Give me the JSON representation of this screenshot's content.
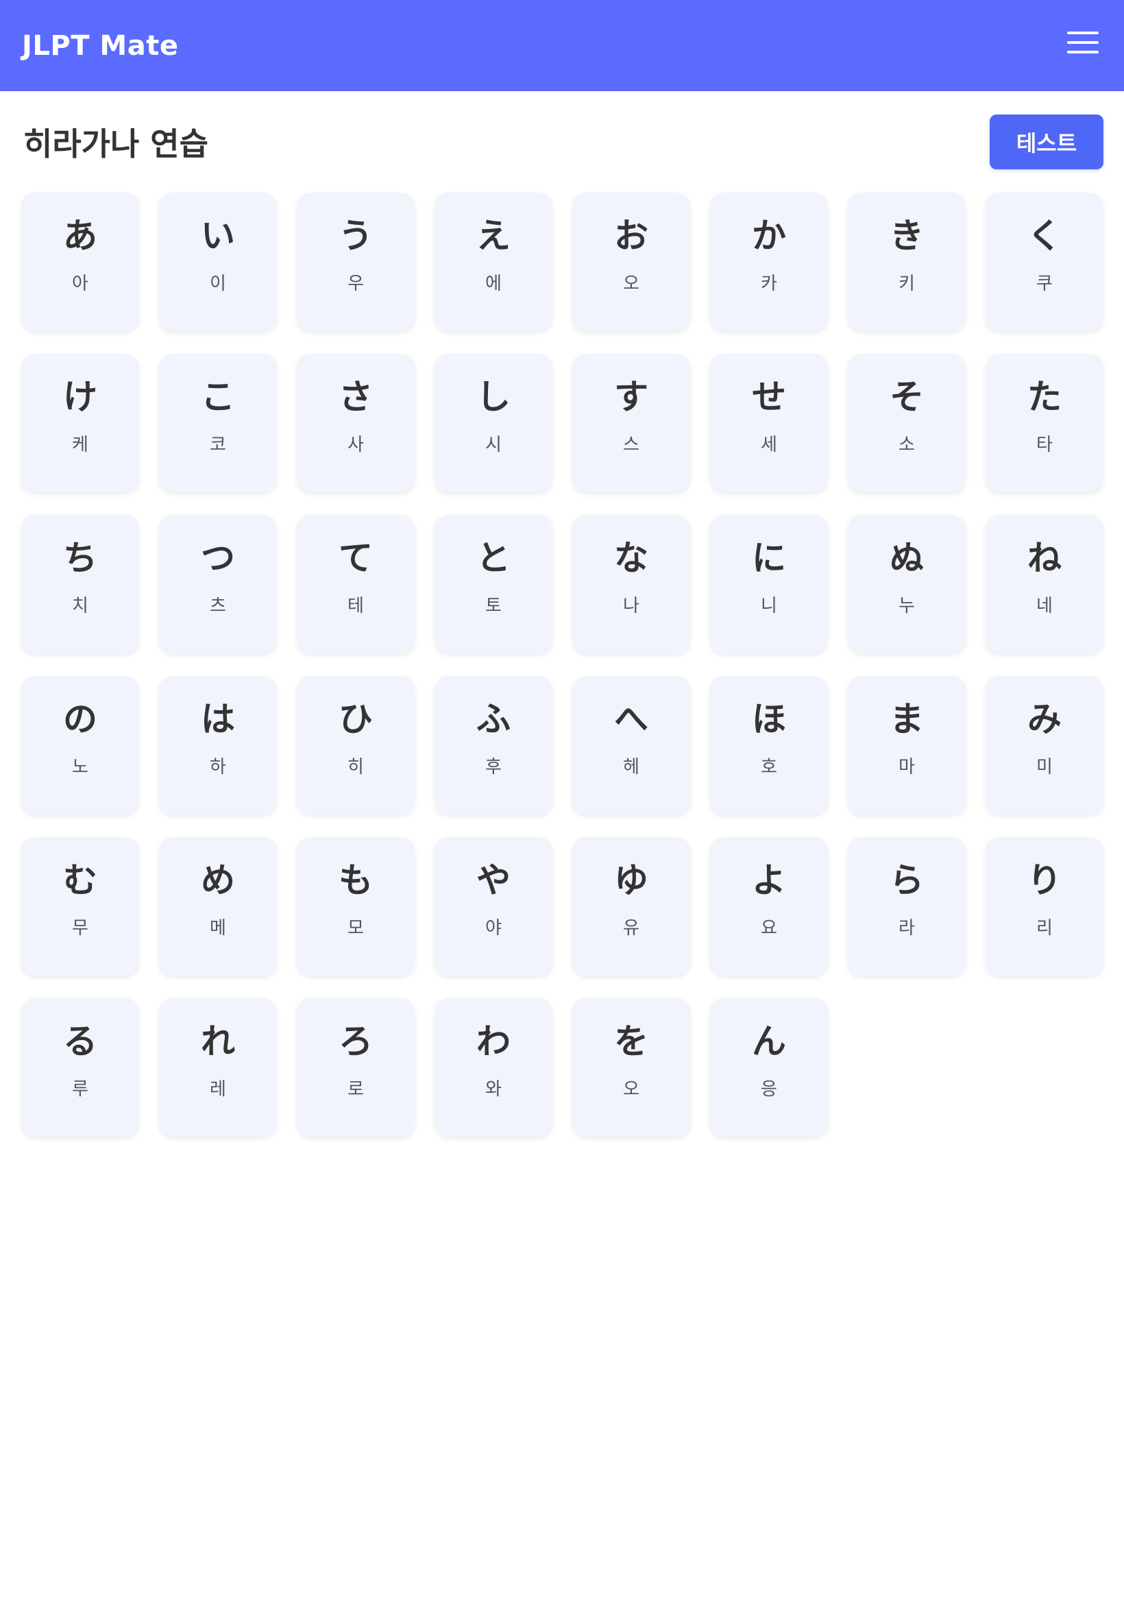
{
  "header": {
    "title": "JLPT Mate",
    "menu_icon": "hamburger-menu-icon"
  },
  "page": {
    "title": "히라가나 연습",
    "test_button": "테스트"
  },
  "colors": {
    "header_bg": "#5b6bff",
    "button_bg": "#4f67f7",
    "card_bg": "#f1f3fd",
    "text": "#333333"
  },
  "cards": [
    {
      "kana": "あ",
      "reading": "아"
    },
    {
      "kana": "い",
      "reading": "이"
    },
    {
      "kana": "う",
      "reading": "우"
    },
    {
      "kana": "え",
      "reading": "에"
    },
    {
      "kana": "お",
      "reading": "오"
    },
    {
      "kana": "か",
      "reading": "카"
    },
    {
      "kana": "き",
      "reading": "키"
    },
    {
      "kana": "く",
      "reading": "쿠"
    },
    {
      "kana": "け",
      "reading": "케"
    },
    {
      "kana": "こ",
      "reading": "코"
    },
    {
      "kana": "さ",
      "reading": "사"
    },
    {
      "kana": "し",
      "reading": "시"
    },
    {
      "kana": "す",
      "reading": "스"
    },
    {
      "kana": "せ",
      "reading": "세"
    },
    {
      "kana": "そ",
      "reading": "소"
    },
    {
      "kana": "た",
      "reading": "타"
    },
    {
      "kana": "ち",
      "reading": "치"
    },
    {
      "kana": "つ",
      "reading": "츠"
    },
    {
      "kana": "て",
      "reading": "테"
    },
    {
      "kana": "と",
      "reading": "토"
    },
    {
      "kana": "な",
      "reading": "나"
    },
    {
      "kana": "に",
      "reading": "니"
    },
    {
      "kana": "ぬ",
      "reading": "누"
    },
    {
      "kana": "ね",
      "reading": "네"
    },
    {
      "kana": "の",
      "reading": "노"
    },
    {
      "kana": "は",
      "reading": "하"
    },
    {
      "kana": "ひ",
      "reading": "히"
    },
    {
      "kana": "ふ",
      "reading": "후"
    },
    {
      "kana": "へ",
      "reading": "헤"
    },
    {
      "kana": "ほ",
      "reading": "호"
    },
    {
      "kana": "ま",
      "reading": "마"
    },
    {
      "kana": "み",
      "reading": "미"
    },
    {
      "kana": "む",
      "reading": "무"
    },
    {
      "kana": "め",
      "reading": "메"
    },
    {
      "kana": "も",
      "reading": "모"
    },
    {
      "kana": "や",
      "reading": "야"
    },
    {
      "kana": "ゆ",
      "reading": "유"
    },
    {
      "kana": "よ",
      "reading": "요"
    },
    {
      "kana": "ら",
      "reading": "라"
    },
    {
      "kana": "り",
      "reading": "리"
    },
    {
      "kana": "る",
      "reading": "루"
    },
    {
      "kana": "れ",
      "reading": "레"
    },
    {
      "kana": "ろ",
      "reading": "로"
    },
    {
      "kana": "わ",
      "reading": "와"
    },
    {
      "kana": "を",
      "reading": "오"
    },
    {
      "kana": "ん",
      "reading": "응"
    }
  ]
}
